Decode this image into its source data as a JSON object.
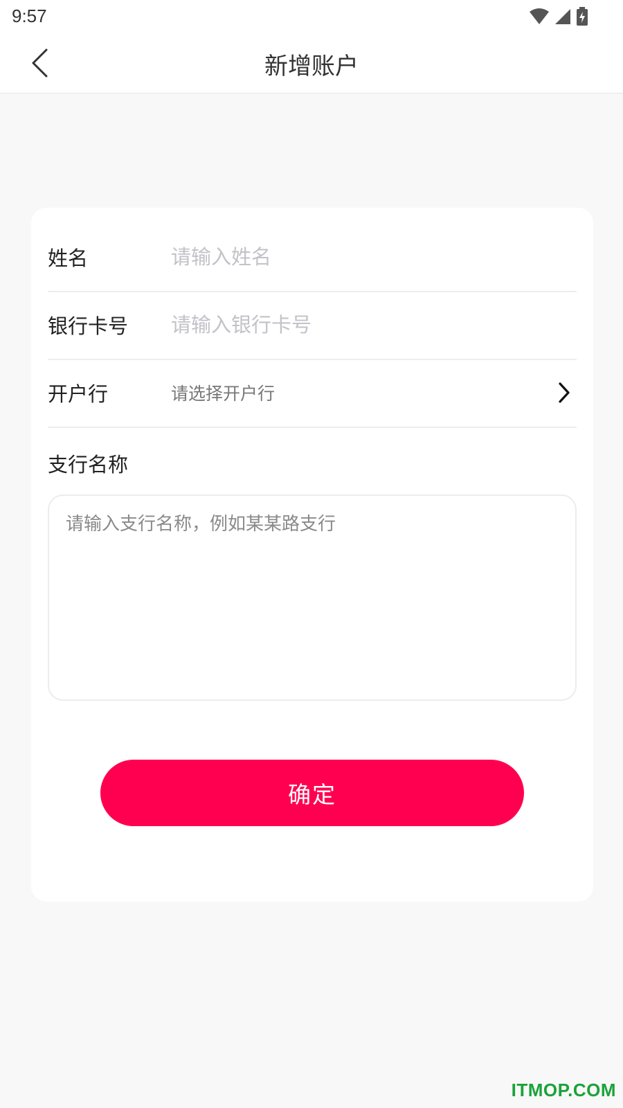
{
  "status_bar": {
    "time": "9:57",
    "icons": [
      "wifi-icon",
      "signal-icon",
      "battery-charging-icon"
    ]
  },
  "header": {
    "title": "新增账户",
    "back_icon": "chevron-left-icon"
  },
  "form": {
    "name": {
      "label": "姓名",
      "placeholder": "请输入姓名",
      "value": ""
    },
    "card_number": {
      "label": "银行卡号",
      "placeholder": "请输入银行卡号",
      "value": ""
    },
    "bank": {
      "label": "开户行",
      "selected_text": "请选择开户行",
      "icon": "chevron-right-icon"
    },
    "branch": {
      "label": "支行名称",
      "placeholder": "请输入支行名称，例如某某路支行",
      "value": ""
    },
    "confirm_label": "确定"
  },
  "colors": {
    "accent": "#ff0050",
    "background": "#f8f8f8",
    "card": "#ffffff",
    "watermark": "#1aa33a"
  },
  "watermark": "ITMOP.COM"
}
